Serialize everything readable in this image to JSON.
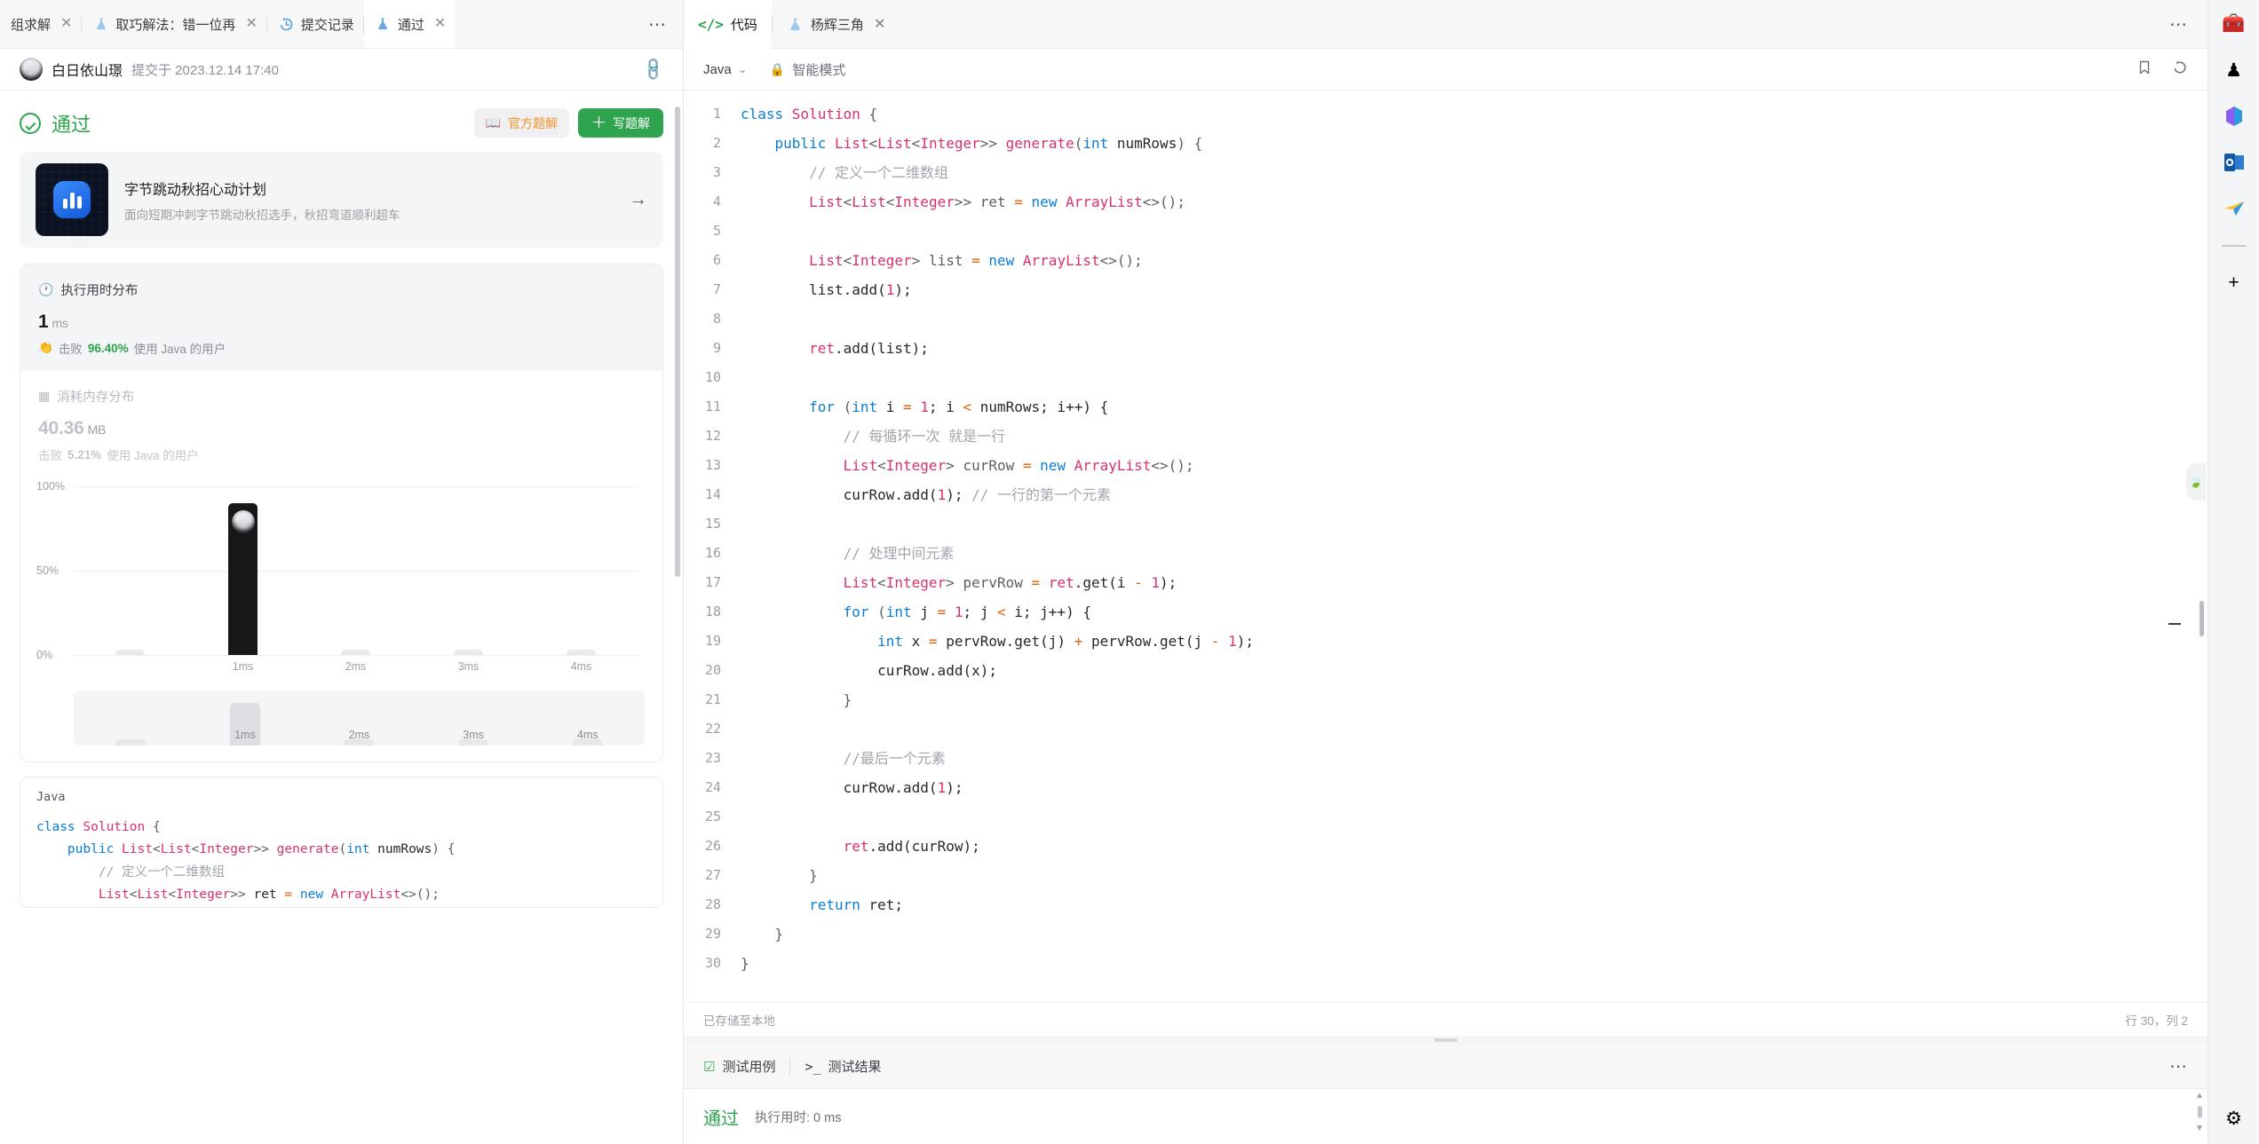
{
  "left": {
    "tabs": [
      {
        "label": "组求解",
        "icon": "",
        "closable": true,
        "active": false
      },
      {
        "label": "取巧解法：错一位再",
        "icon": "flask-icon",
        "closable": true,
        "active": false
      },
      {
        "label": "提交记录",
        "icon": "history-icon",
        "closable": false,
        "active": false
      },
      {
        "label": "通过",
        "icon": "flask-icon",
        "closable": true,
        "active": true
      }
    ],
    "more_label": "⋯",
    "submitter": {
      "name": "白日依山璟",
      "meta": "提交于 2023.12.14 17:40",
      "link_icon": "link-icon"
    },
    "status": {
      "text": "通过",
      "official_solution_label": "官方题解",
      "write_solution_label": "写题解"
    },
    "promo": {
      "title": "字节跳动秋招心动计划",
      "subtitle": "面向短期冲刺字节跳动秋招选手，秋招弯道顺利超车",
      "arrow": "→"
    },
    "runtime": {
      "header": "执行用时分布",
      "value": "1",
      "unit": "ms",
      "beat_prefix": "击败",
      "beat_percent": "96.40%",
      "beat_suffix": "使用 Java 的用户"
    },
    "memory": {
      "header": "消耗内存分布",
      "value": "40.36",
      "unit": "MB",
      "beat_prefix": "击败",
      "beat_percent": "5.21%",
      "beat_suffix": "使用 Java 的用户"
    },
    "code_card": {
      "language": "Java",
      "lines": [
        [
          {
            "t": "class ",
            "c": "k"
          },
          {
            "t": "Solution ",
            "c": "t"
          },
          {
            "t": "{",
            "c": "p"
          }
        ],
        [
          {
            "t": "    public ",
            "c": "k"
          },
          {
            "t": "List",
            "c": "t"
          },
          {
            "t": "<",
            "c": "p"
          },
          {
            "t": "List",
            "c": "t"
          },
          {
            "t": "<",
            "c": "p"
          },
          {
            "t": "Integer",
            "c": "t"
          },
          {
            "t": ">> ",
            "c": "p"
          },
          {
            "t": "generate",
            "c": "t"
          },
          {
            "t": "(",
            "c": "p"
          },
          {
            "t": "int ",
            "c": "k"
          },
          {
            "t": "numRows",
            "c": "v"
          },
          {
            "t": ") {",
            "c": "p"
          }
        ],
        [
          {
            "t": "        // 定义一个二维数组",
            "c": "c"
          }
        ],
        [
          {
            "t": "        List",
            "c": "t"
          },
          {
            "t": "<",
            "c": "p"
          },
          {
            "t": "List",
            "c": "t"
          },
          {
            "t": "<",
            "c": "p"
          },
          {
            "t": "Integer",
            "c": "t"
          },
          {
            "t": ">> ",
            "c": "p"
          },
          {
            "t": "ret ",
            "c": "v"
          },
          {
            "t": "= ",
            "c": "o"
          },
          {
            "t": "new ",
            "c": "k"
          },
          {
            "t": "ArrayList",
            "c": "t"
          },
          {
            "t": "<>();",
            "c": "p"
          }
        ]
      ]
    }
  },
  "chart_data": {
    "type": "bar",
    "title": "执行用时分布",
    "xlabel": "",
    "ylabel": "",
    "ylim": [
      0,
      100
    ],
    "ytick_labels": [
      "100%",
      "50%",
      "0%"
    ],
    "ytick_values": [
      100,
      50,
      0
    ],
    "categories": [
      "",
      "1ms",
      "2ms",
      "3ms",
      "4ms"
    ],
    "values": [
      3,
      90,
      3,
      3,
      3
    ],
    "highlight_index": 1,
    "highlight_color": "#17171a",
    "bar_color": "#e9eaec",
    "grid": true,
    "legend": "none",
    "minimap": {
      "categories": [
        "",
        "1ms",
        "2ms",
        "3ms",
        "4ms"
      ],
      "values": [
        12,
        72,
        12,
        12,
        12
      ],
      "selected_index": 1
    }
  },
  "editor": {
    "tabs": [
      {
        "label": "代码",
        "icon": "code-icon",
        "active": true,
        "closable": false
      },
      {
        "label": "杨辉三角",
        "icon": "flask-icon",
        "active": false,
        "closable": true
      }
    ],
    "more_label": "⋯",
    "toolbar": {
      "language": "Java",
      "caret": "⌄",
      "smart_mode": "智能模式",
      "bookmark_icon": "bookmark-icon",
      "reset_icon": "reset-icon"
    },
    "status_left": "已存储至本地",
    "status_right": "行 30，列 2",
    "lines": [
      {
        "n": "1",
        "parts": [
          {
            "t": "class ",
            "c": "k"
          },
          {
            "t": "Solution ",
            "c": "t"
          },
          {
            "t": "{",
            "c": "p"
          }
        ]
      },
      {
        "n": "2",
        "parts": [
          {
            "t": "    public ",
            "c": "k"
          },
          {
            "t": "List",
            "c": "t"
          },
          {
            "t": "<",
            "c": "p"
          },
          {
            "t": "List",
            "c": "t"
          },
          {
            "t": "<",
            "c": "p"
          },
          {
            "t": "Integer",
            "c": "t"
          },
          {
            "t": ">> ",
            "c": "p"
          },
          {
            "t": "generate",
            "c": "t"
          },
          {
            "t": "(",
            "c": "p"
          },
          {
            "t": "int ",
            "c": "k"
          },
          {
            "t": "numRows",
            "c": "v"
          },
          {
            "t": ") {",
            "c": "p"
          }
        ]
      },
      {
        "n": "3",
        "parts": [
          {
            "t": "        // 定义一个二维数组",
            "c": "c"
          }
        ]
      },
      {
        "n": "4",
        "parts": [
          {
            "t": "        List",
            "c": "t"
          },
          {
            "t": "<",
            "c": "p"
          },
          {
            "t": "List",
            "c": "t"
          },
          {
            "t": "<",
            "c": "p"
          },
          {
            "t": "Integer",
            "c": "t"
          },
          {
            "t": ">> ret ",
            "c": "p"
          },
          {
            "t": "= ",
            "c": "o"
          },
          {
            "t": "new ",
            "c": "k"
          },
          {
            "t": "ArrayList",
            "c": "t"
          },
          {
            "t": "<>();",
            "c": "p"
          }
        ]
      },
      {
        "n": "5",
        "parts": [
          {
            "t": "",
            "c": "v"
          }
        ]
      },
      {
        "n": "6",
        "parts": [
          {
            "t": "        List",
            "c": "t"
          },
          {
            "t": "<",
            "c": "p"
          },
          {
            "t": "Integer",
            "c": "t"
          },
          {
            "t": "> list ",
            "c": "p"
          },
          {
            "t": "= ",
            "c": "o"
          },
          {
            "t": "new ",
            "c": "k"
          },
          {
            "t": "ArrayList",
            "c": "t"
          },
          {
            "t": "<>();",
            "c": "p"
          }
        ]
      },
      {
        "n": "7",
        "parts": [
          {
            "t": "        list.add(",
            "c": "v"
          },
          {
            "t": "1",
            "c": "t"
          },
          {
            "t": ");",
            "c": "v"
          }
        ]
      },
      {
        "n": "8",
        "parts": [
          {
            "t": "",
            "c": "v"
          }
        ]
      },
      {
        "n": "9",
        "parts": [
          {
            "t": "        ret",
            "c": "t"
          },
          {
            "t": ".add(list);",
            "c": "v"
          }
        ]
      },
      {
        "n": "10",
        "parts": [
          {
            "t": "",
            "c": "v"
          }
        ]
      },
      {
        "n": "11",
        "parts": [
          {
            "t": "        for ",
            "c": "k"
          },
          {
            "t": "(",
            "c": "p"
          },
          {
            "t": "int ",
            "c": "k"
          },
          {
            "t": "i ",
            "c": "v"
          },
          {
            "t": "= ",
            "c": "o"
          },
          {
            "t": "1",
            "c": "t"
          },
          {
            "t": "; i ",
            "c": "v"
          },
          {
            "t": "< ",
            "c": "o"
          },
          {
            "t": "numRows; i++) {",
            "c": "v"
          }
        ]
      },
      {
        "n": "12",
        "parts": [
          {
            "t": "            // 每循环一次 就是一行",
            "c": "c"
          }
        ]
      },
      {
        "n": "13",
        "parts": [
          {
            "t": "            List",
            "c": "t"
          },
          {
            "t": "<",
            "c": "p"
          },
          {
            "t": "Integer",
            "c": "t"
          },
          {
            "t": "> curRow ",
            "c": "p"
          },
          {
            "t": "= ",
            "c": "o"
          },
          {
            "t": "new ",
            "c": "k"
          },
          {
            "t": "ArrayList",
            "c": "t"
          },
          {
            "t": "<>();",
            "c": "p"
          }
        ]
      },
      {
        "n": "14",
        "parts": [
          {
            "t": "            curRow.add(",
            "c": "v"
          },
          {
            "t": "1",
            "c": "t"
          },
          {
            "t": "); ",
            "c": "v"
          },
          {
            "t": "// 一行的第一个元素",
            "c": "c"
          }
        ]
      },
      {
        "n": "15",
        "parts": [
          {
            "t": "",
            "c": "v"
          }
        ]
      },
      {
        "n": "16",
        "parts": [
          {
            "t": "            // 处理中间元素",
            "c": "c"
          }
        ]
      },
      {
        "n": "17",
        "parts": [
          {
            "t": "            List",
            "c": "t"
          },
          {
            "t": "<",
            "c": "p"
          },
          {
            "t": "Integer",
            "c": "t"
          },
          {
            "t": "> pervRow ",
            "c": "p"
          },
          {
            "t": "= ",
            "c": "o"
          },
          {
            "t": "ret",
            "c": "t"
          },
          {
            "t": ".get(i ",
            "c": "v"
          },
          {
            "t": "- ",
            "c": "o"
          },
          {
            "t": "1",
            "c": "t"
          },
          {
            "t": ");",
            "c": "v"
          }
        ]
      },
      {
        "n": "18",
        "parts": [
          {
            "t": "            for ",
            "c": "k"
          },
          {
            "t": "(",
            "c": "p"
          },
          {
            "t": "int ",
            "c": "k"
          },
          {
            "t": "j ",
            "c": "v"
          },
          {
            "t": "= ",
            "c": "o"
          },
          {
            "t": "1",
            "c": "t"
          },
          {
            "t": "; j ",
            "c": "v"
          },
          {
            "t": "< ",
            "c": "o"
          },
          {
            "t": "i; j++) {",
            "c": "v"
          }
        ]
      },
      {
        "n": "19",
        "parts": [
          {
            "t": "                int ",
            "c": "k"
          },
          {
            "t": "x ",
            "c": "v"
          },
          {
            "t": "= ",
            "c": "o"
          },
          {
            "t": "pervRow.get(j) ",
            "c": "v"
          },
          {
            "t": "+ ",
            "c": "o"
          },
          {
            "t": "pervRow.get(j ",
            "c": "v"
          },
          {
            "t": "- ",
            "c": "o"
          },
          {
            "t": "1",
            "c": "t"
          },
          {
            "t": ");",
            "c": "v"
          }
        ]
      },
      {
        "n": "20",
        "parts": [
          {
            "t": "                curRow.add(x);",
            "c": "v"
          }
        ]
      },
      {
        "n": "21",
        "parts": [
          {
            "t": "            }",
            "c": "p"
          }
        ]
      },
      {
        "n": "22",
        "parts": [
          {
            "t": "",
            "c": "v"
          }
        ]
      },
      {
        "n": "23",
        "parts": [
          {
            "t": "            //最后一个元素",
            "c": "c"
          }
        ]
      },
      {
        "n": "24",
        "parts": [
          {
            "t": "            curRow.add(",
            "c": "v"
          },
          {
            "t": "1",
            "c": "t"
          },
          {
            "t": ");",
            "c": "v"
          }
        ]
      },
      {
        "n": "25",
        "parts": [
          {
            "t": "",
            "c": "v"
          }
        ]
      },
      {
        "n": "26",
        "parts": [
          {
            "t": "            ret",
            "c": "t"
          },
          {
            "t": ".add(curRow);",
            "c": "v"
          }
        ]
      },
      {
        "n": "27",
        "parts": [
          {
            "t": "        }",
            "c": "p"
          }
        ]
      },
      {
        "n": "28",
        "parts": [
          {
            "t": "        return ",
            "c": "k"
          },
          {
            "t": "ret;",
            "c": "v"
          }
        ]
      },
      {
        "n": "29",
        "parts": [
          {
            "t": "    }",
            "c": "p"
          }
        ]
      },
      {
        "n": "30",
        "parts": [
          {
            "t": "}",
            "c": "p"
          }
        ]
      }
    ]
  },
  "console": {
    "tabs": [
      {
        "label": "测试用例",
        "icon": "checkbox-icon"
      },
      {
        "label": "测试结果",
        "icon": "terminal-icon"
      }
    ],
    "more_label": "⋯",
    "verdict": "通过",
    "runtime_label": "执行用时: 0 ms"
  },
  "dock": {
    "items": [
      {
        "name": "toolbox-icon",
        "glyph": "🧰"
      },
      {
        "name": "chess-icon",
        "glyph": "♟"
      },
      {
        "name": "microsoft365-icon",
        "glyph": "⬣"
      },
      {
        "name": "outlook-icon",
        "glyph": "✉"
      },
      {
        "name": "paperplane-icon",
        "glyph": "✈"
      }
    ],
    "add_label": "+",
    "settings_icon": "gear-icon"
  }
}
